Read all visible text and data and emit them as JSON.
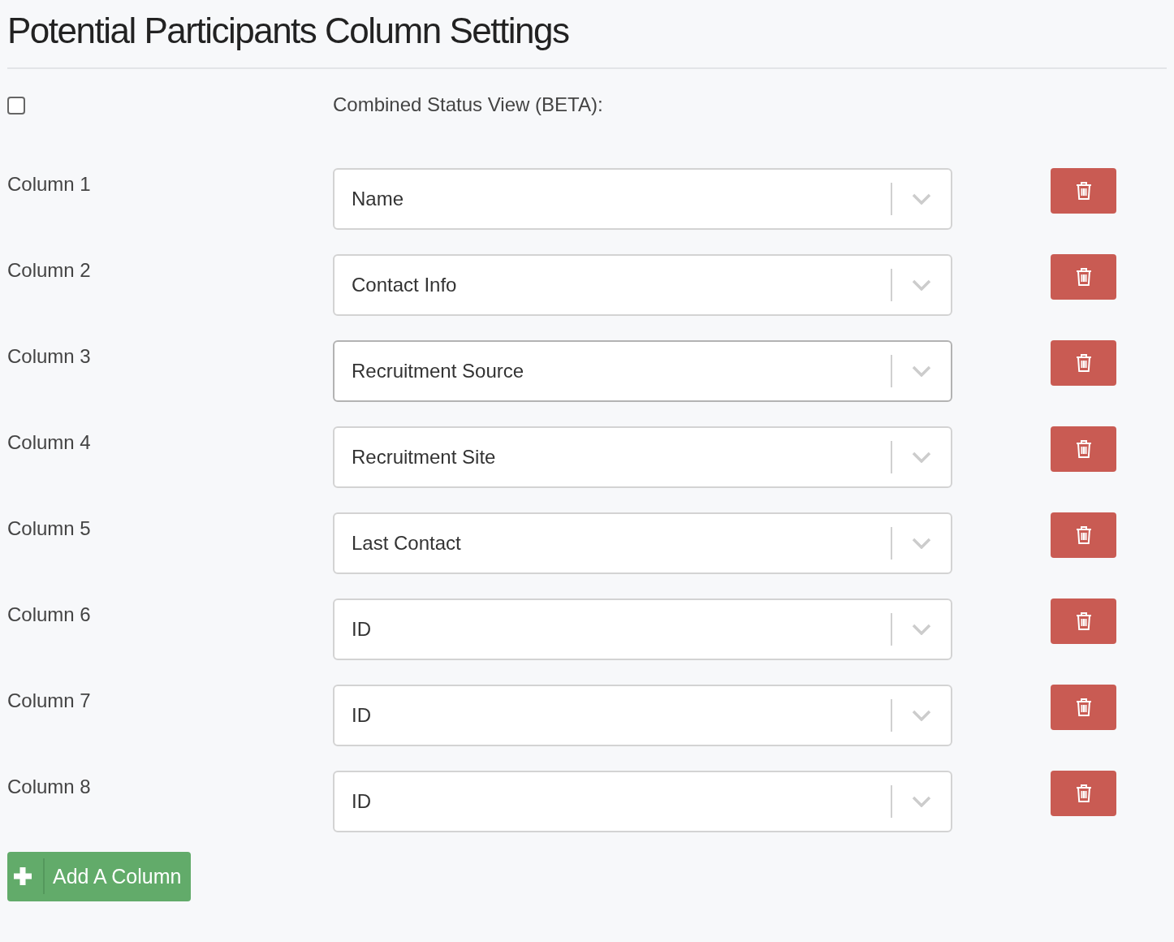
{
  "title": "Potential Participants Column Settings",
  "combined_status": {
    "checked": false,
    "label": "Combined Status View (BETA):"
  },
  "columns": [
    {
      "label": "Column 1",
      "value": "Name",
      "focused": false
    },
    {
      "label": "Column 2",
      "value": "Contact Info",
      "focused": false
    },
    {
      "label": "Column 3",
      "value": "Recruitment Source",
      "focused": true
    },
    {
      "label": "Column 4",
      "value": "Recruitment Site",
      "focused": false
    },
    {
      "label": "Column 5",
      "value": "Last Contact",
      "focused": false
    },
    {
      "label": "Column 6",
      "value": "ID",
      "focused": false
    },
    {
      "label": "Column 7",
      "value": "ID",
      "focused": false
    },
    {
      "label": "Column 8",
      "value": "ID",
      "focused": false
    }
  ],
  "add_button": {
    "label": "Add A Column"
  }
}
